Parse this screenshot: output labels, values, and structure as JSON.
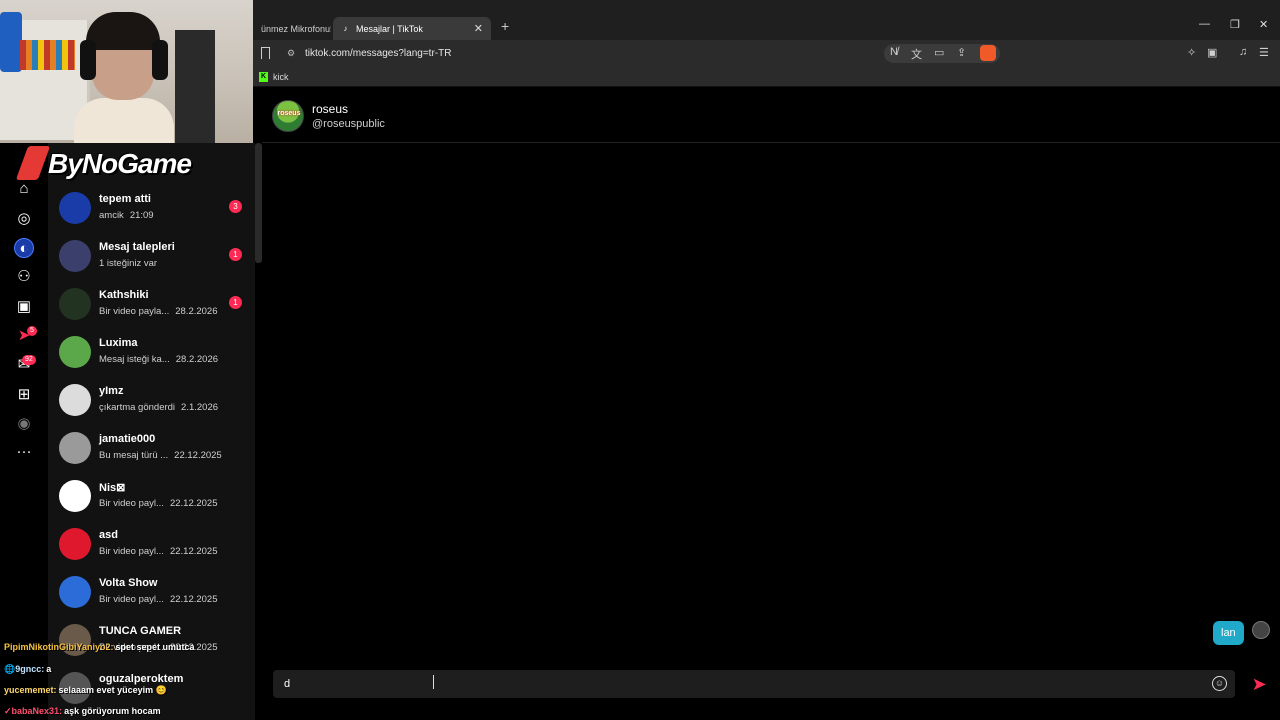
{
  "browser": {
    "tabs": [
      {
        "title": "ünmez Mikrofonu!",
        "active": false
      },
      {
        "title": "Mesajlar | TikTok",
        "active": true
      }
    ],
    "url": "tiktok.com/messages?lang=tr-TR",
    "bookmarks": [
      {
        "label": "kick"
      }
    ]
  },
  "overlay": {
    "logo_text": "ByNoGame"
  },
  "rail": {
    "notification_badge": "5",
    "inbox_badge": "92",
    "more": "···"
  },
  "chat_list": [
    {
      "name": "tepem atti",
      "preview": "amcik",
      "date": "21:09",
      "unread": "3",
      "avatar_color": "#1a3ca8"
    },
    {
      "name": "Mesaj talepleri",
      "preview": "1 isteğiniz var",
      "date": "",
      "unread": "1",
      "avatar_color": "#3b3f6b"
    },
    {
      "name": "Kathshiki",
      "preview": "Bir video payla...",
      "date": "28.2.2026",
      "unread": "1",
      "avatar_color": "#223322"
    },
    {
      "name": "Luxima",
      "preview": "Mesaj isteği ka...",
      "date": "28.2.2026",
      "unread": "",
      "avatar_color": "#5aa84a"
    },
    {
      "name": "yImz",
      "preview": "çıkartma gönderdi",
      "date": "2.1.2026",
      "unread": "",
      "avatar_color": "#dcdcdc"
    },
    {
      "name": "jamatie000",
      "preview": "Bu mesaj türü ...",
      "date": "22.12.2025",
      "unread": "",
      "avatar_color": "#9a9a9a"
    },
    {
      "name": "Nis⊠",
      "preview": "Bir video payl...",
      "date": "22.12.2025",
      "unread": "",
      "avatar_color": "#ffffff"
    },
    {
      "name": "asd",
      "preview": "Bir video payl...",
      "date": "22.12.2025",
      "unread": "",
      "avatar_color": "#e0182d"
    },
    {
      "name": "Volta Show",
      "preview": "Bir video payl...",
      "date": "22.12.2025",
      "unread": "",
      "avatar_color": "#2b6cd8"
    },
    {
      "name": "TUNCA GAMER",
      "preview": "Bir video payl...",
      "date": "22.12.2025",
      "unread": "",
      "avatar_color": "#6a5a4a"
    },
    {
      "name": "oguzalperoktem",
      "preview": "",
      "date": "",
      "unread": "",
      "avatar_color": "#555555"
    }
  ],
  "conversation": {
    "name": "roseus",
    "handle": "@roseuspublic",
    "avatar_text": "roseus",
    "messages": [
      {
        "text": "lan",
        "from_me": true
      }
    ],
    "composer_value": "d"
  },
  "stream_chat": [
    {
      "user": "PipimNikotinGibiYaniyo2:",
      "msg": "spet sepet umutca",
      "color": "#f5c242"
    },
    {
      "user": "🌐9gncc:",
      "msg": "a",
      "color": "#bfe3ff"
    },
    {
      "user": "yucememet:",
      "msg": "selaaam evet yüceyim 😊",
      "color": "#ffd86b"
    },
    {
      "user": "✓babaNex31:",
      "msg": "aşk görüyorum hocam",
      "color": "#ff4d6d"
    }
  ],
  "colors": {
    "accent": "#fe2c55",
    "bubble": "#20a9c8"
  }
}
